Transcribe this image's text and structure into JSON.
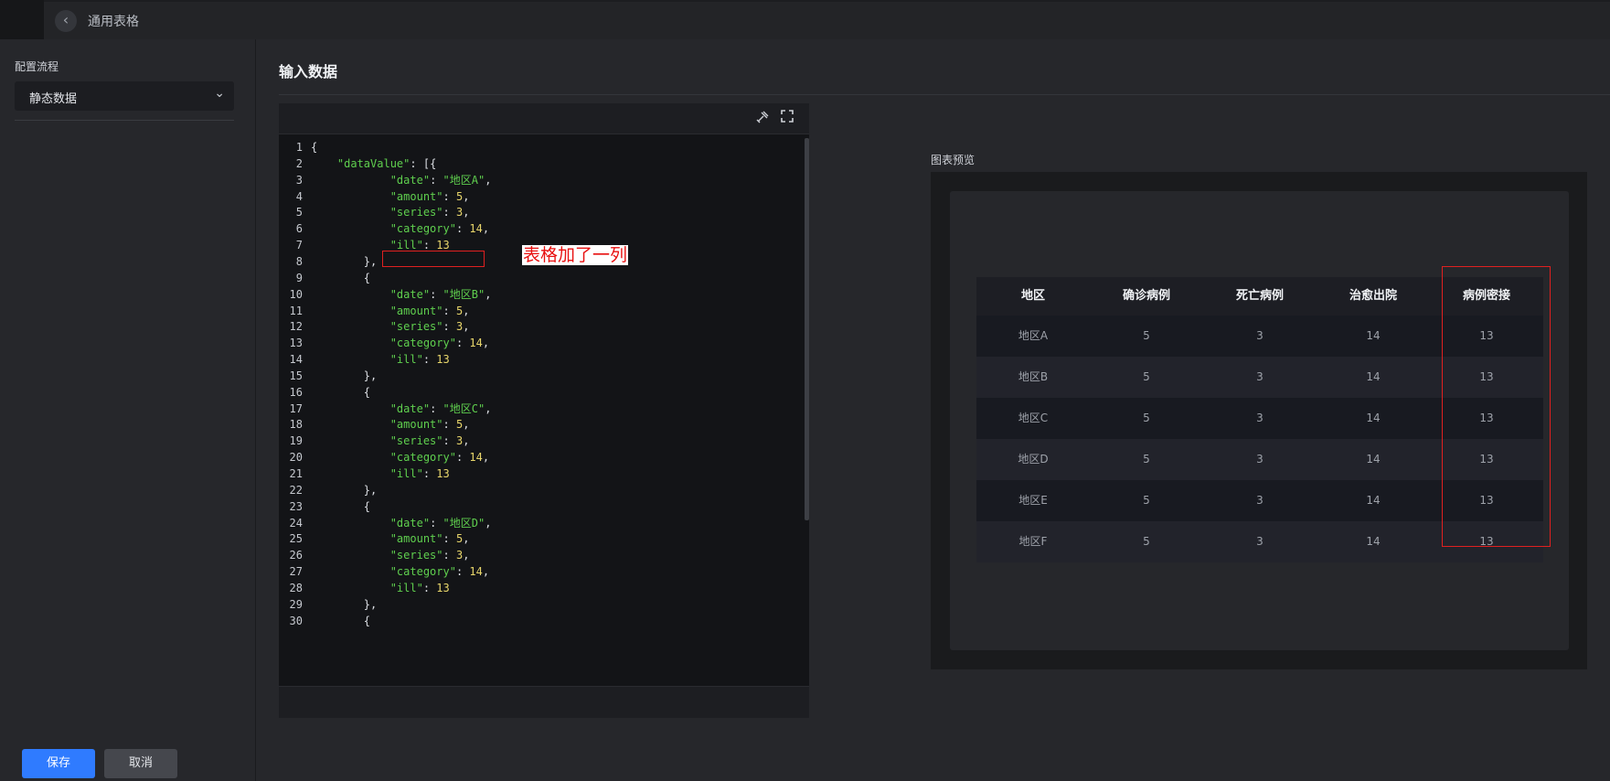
{
  "header": {
    "title": "通用表格",
    "back_icon": "chevron-left-icon"
  },
  "sidebar": {
    "label": "配置流程",
    "select_value": "静态数据",
    "save_label": "保存",
    "cancel_label": "取消"
  },
  "main": {
    "title": "输入数据"
  },
  "editor": {
    "lines": [
      "{",
      "    \"dataValue\": [{",
      "            \"date\": \"地区A\",",
      "            \"amount\": 5,",
      "            \"series\": 3,",
      "            \"category\": 14,",
      "            \"ill\": 13",
      "        },",
      "        {",
      "            \"date\": \"地区B\",",
      "            \"amount\": 5,",
      "            \"series\": 3,",
      "            \"category\": 14,",
      "            \"ill\": 13",
      "        },",
      "        {",
      "            \"date\": \"地区C\",",
      "            \"amount\": 5,",
      "            \"series\": 3,",
      "            \"category\": 14,",
      "            \"ill\": 13",
      "        },",
      "        {",
      "            \"date\": \"地区D\",",
      "            \"amount\": 5,",
      "            \"series\": 3,",
      "            \"category\": 14,",
      "            \"ill\": 13",
      "        },",
      "        {"
    ],
    "tools": [
      "format-icon",
      "fullscreen-icon"
    ]
  },
  "annotation": {
    "text": "表格加了一列"
  },
  "preview": {
    "label": "图表预览",
    "table": {
      "headers": [
        "地区",
        "确诊病例",
        "死亡病例",
        "治愈出院",
        "病例密接"
      ],
      "rows": [
        [
          "地区A",
          "5",
          "3",
          "14",
          "13"
        ],
        [
          "地区B",
          "5",
          "3",
          "14",
          "13"
        ],
        [
          "地区C",
          "5",
          "3",
          "14",
          "13"
        ],
        [
          "地区D",
          "5",
          "3",
          "14",
          "13"
        ],
        [
          "地区E",
          "5",
          "3",
          "14",
          "13"
        ],
        [
          "地区F",
          "5",
          "3",
          "14",
          "13"
        ]
      ],
      "row_colors": [
        "#181a21",
        "#22232b"
      ]
    }
  },
  "colors": {
    "accent": "#2f7bff",
    "annotation": "#e02020"
  }
}
